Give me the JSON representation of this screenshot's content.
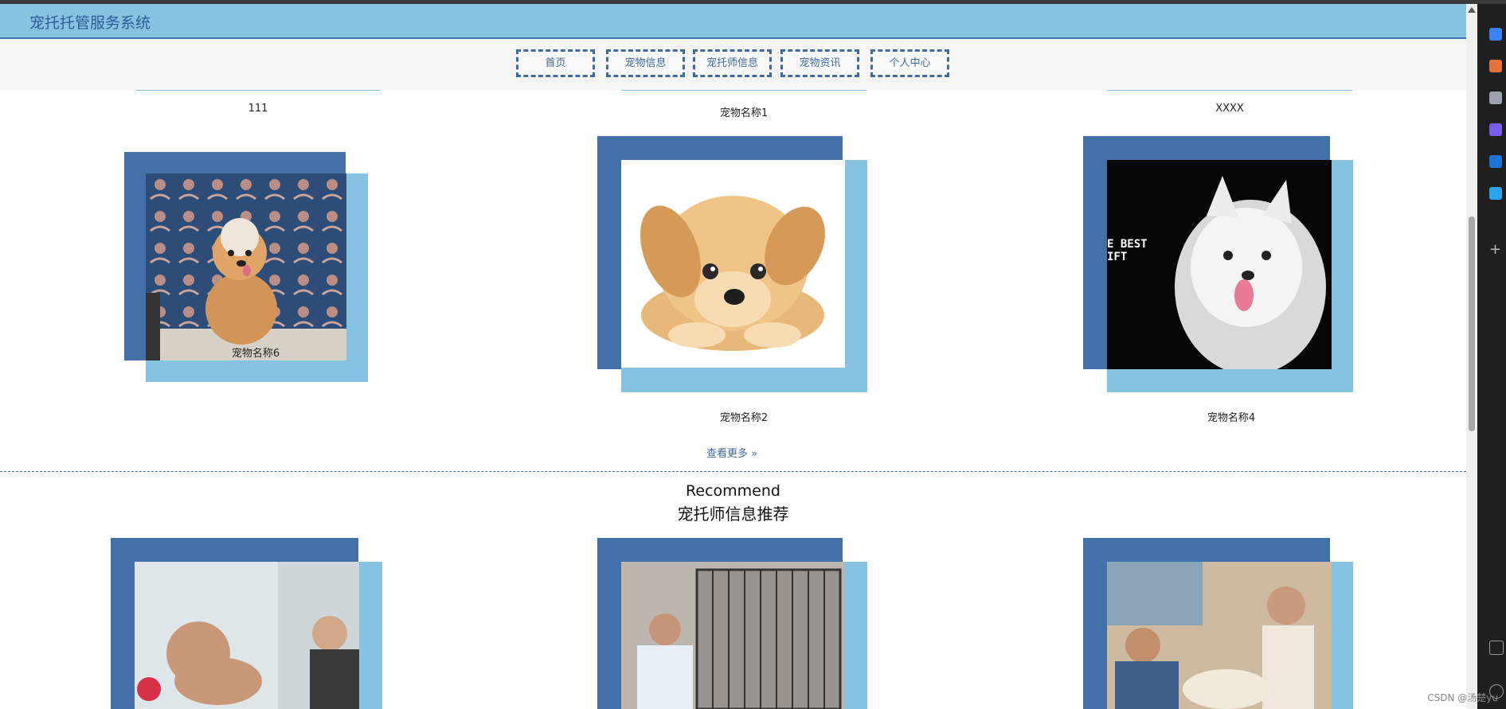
{
  "header": {
    "title": "宠托托管服务系统"
  },
  "nav": {
    "items": [
      "首页",
      "宠物信息",
      "宠托师信息",
      "宠物资讯",
      "个人中心"
    ]
  },
  "pets": {
    "top_captions": [
      "111",
      "宠物名称1",
      "XXXX"
    ],
    "cards": [
      {
        "caption": "宠物名称6"
      },
      {
        "caption": "宠物名称2"
      },
      {
        "caption": "宠物名称4",
        "photo_text": "E BEST\nIFT"
      }
    ],
    "more_label": "查看更多 »"
  },
  "recommend": {
    "title": "Recommend",
    "subtitle": "宠托师信息推荐"
  },
  "watermark": "CSDN @汤楚yu",
  "colors": {
    "header_bg": "#86c3e3",
    "frame_dark": "#4470aa",
    "frame_light": "#86c3e3",
    "accent": "#3f6aa6"
  }
}
